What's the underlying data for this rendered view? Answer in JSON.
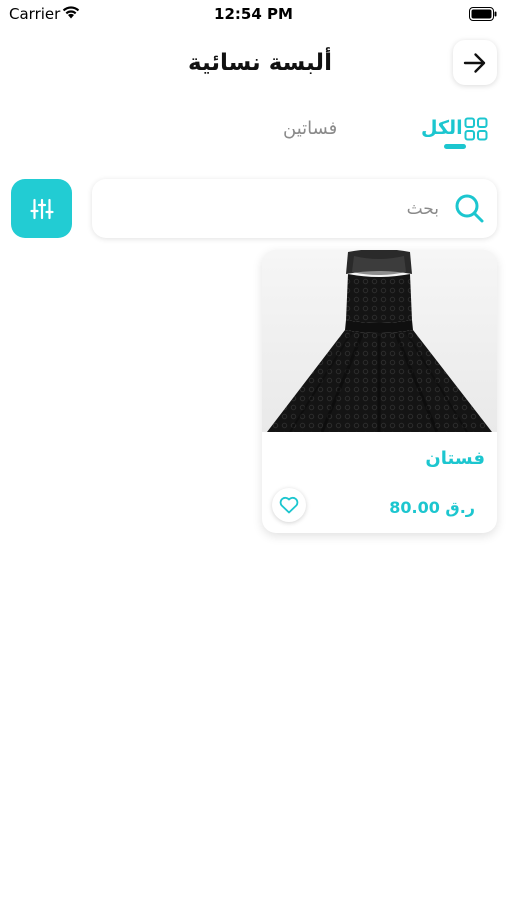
{
  "status_bar": {
    "carrier": "Carrier",
    "time": "12:54 PM"
  },
  "header": {
    "title": "ألبسة نسائية",
    "back_icon": "arrow-right-icon"
  },
  "tabs": [
    {
      "label": "الكل",
      "icon": "grid-icon",
      "active": true
    },
    {
      "label": "فساتين",
      "active": false
    }
  ],
  "search": {
    "placeholder": "بحث",
    "value": "",
    "icon": "search-icon",
    "filter_icon": "sliders-icon"
  },
  "products": [
    {
      "name": "فستان",
      "price": "80.00 ر.ق",
      "favorite": false
    }
  ],
  "colors": {
    "accent": "#1cc6cf",
    "filter_button": "#22ccd3",
    "inactive_tab": "#8a8a8a"
  }
}
